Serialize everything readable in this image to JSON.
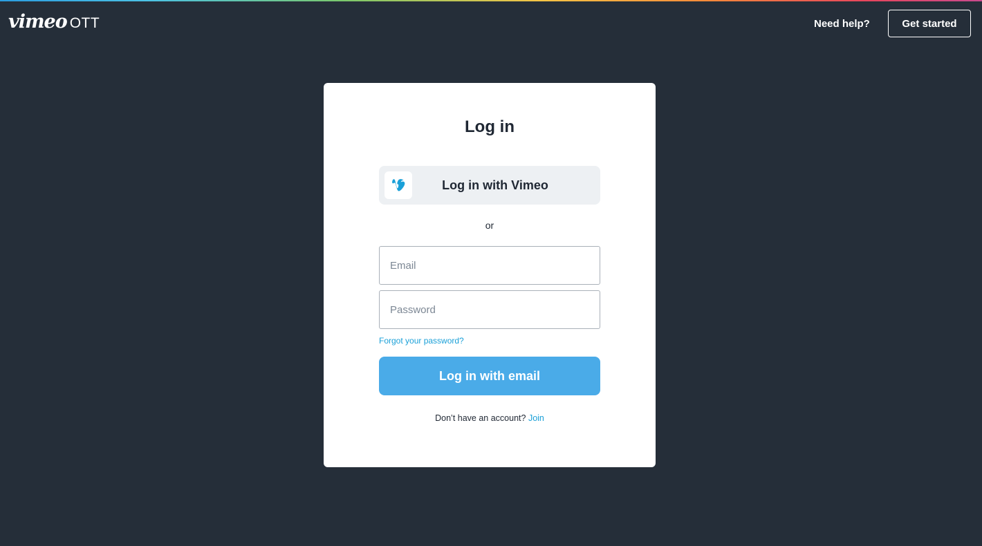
{
  "header": {
    "logo_brand": "vimeo",
    "logo_product": "OTT",
    "help_link": "Need help?",
    "get_started_button": "Get started"
  },
  "login": {
    "title": "Log in",
    "vimeo_button": "Log in with Vimeo",
    "divider_text": "or",
    "email_placeholder": "Email",
    "email_value": "",
    "password_placeholder": "Password",
    "password_value": "",
    "forgot_link": "Forgot your password?",
    "email_button": "Log in with email",
    "no_account_text": "Don’t have an account?",
    "join_link": "Join"
  },
  "colors": {
    "background": "#252e39",
    "card": "#ffffff",
    "accent": "#4aabe8",
    "link": "#1aa0d8"
  },
  "icons": {
    "vimeo_button_icon": "vimeo-v-icon"
  }
}
